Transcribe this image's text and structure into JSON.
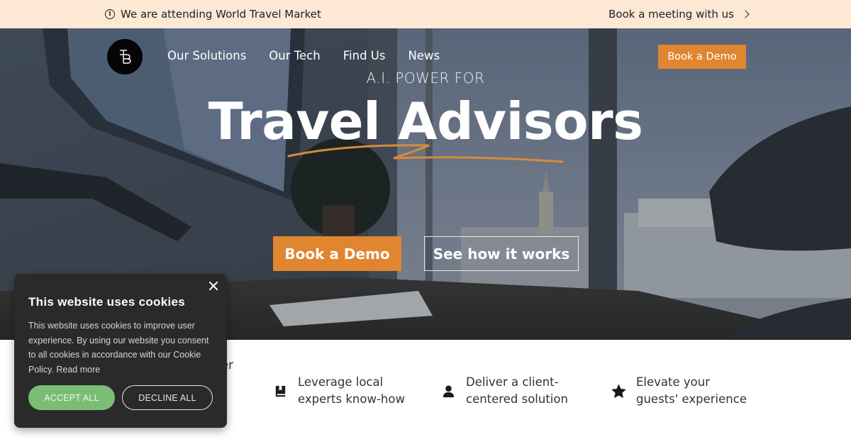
{
  "announcement": {
    "icon": "info-icon",
    "text": "We are attending World Travel Market",
    "link_label": "Book a meeting with us",
    "link_icon": "chevron-right-icon"
  },
  "header": {
    "logo_text": "TB",
    "nav": [
      {
        "label": "Our Solutions"
      },
      {
        "label": "Our Tech"
      },
      {
        "label": "Find Us"
      },
      {
        "label": "News"
      }
    ],
    "cta_label": "Book a Demo"
  },
  "hero": {
    "eyebrow": "A.I. POWER FOR",
    "headline": "Travel Advisors",
    "primary_button": "Book a Demo",
    "secondary_button": "See how it works"
  },
  "features": [
    {
      "icon": "hidden-icon",
      "text": "er"
    },
    {
      "icon": "book-icon",
      "text": "Leverage local\nexperts know-how"
    },
    {
      "icon": "user-icon",
      "text": "Deliver a client-\ncentered solution"
    },
    {
      "icon": "star-icon",
      "text": "Elevate your\nguests' experience"
    }
  ],
  "cookie_banner": {
    "title": "This website uses cookies",
    "body": "This website uses cookies to improve user experience. By using our website you consent to all cookies in accordance with our Cookie Policy.",
    "read_more": "Read more",
    "accept_label": "ACCEPT ALL",
    "decline_label": "DECLINE ALL"
  },
  "colors": {
    "accent": "#e08530",
    "announcement_bg": "#fce8d5",
    "cookie_bg": "#2a2a2a",
    "accept_green": "#7bbd75"
  }
}
